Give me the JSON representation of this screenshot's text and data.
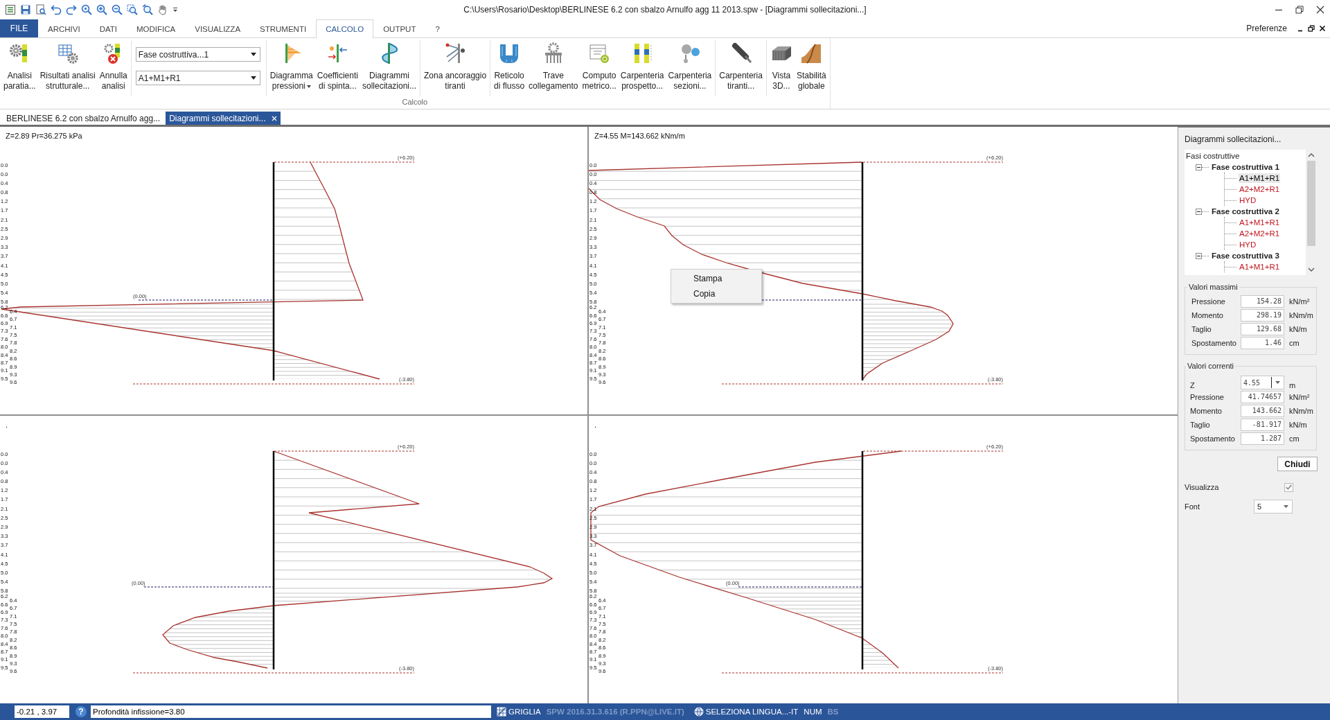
{
  "window": {
    "title": "C:\\Users\\Rosario\\Desktop\\BERLINESE 6.2 con sbalzo Arnulfo agg 11 2013.spw - [Diagrammi sollecitazioni...]"
  },
  "ribbon_tabs": [
    {
      "label": "FILE",
      "kind": "file",
      "selected": false
    },
    {
      "label": "ARCHIVI",
      "kind": "tab",
      "selected": false
    },
    {
      "label": "DATI",
      "kind": "tab",
      "selected": false
    },
    {
      "label": "MODIFICA",
      "kind": "tab",
      "selected": false
    },
    {
      "label": "VISUALIZZA",
      "kind": "tab",
      "selected": false
    },
    {
      "label": "STRUMENTI",
      "kind": "tab",
      "selected": false
    },
    {
      "label": "CALCOLO",
      "kind": "tab",
      "selected": true
    },
    {
      "label": "OUTPUT",
      "kind": "tab",
      "selected": false
    },
    {
      "label": "?",
      "kind": "tab",
      "selected": false
    }
  ],
  "preferences_link": "Preferenze",
  "ribbon": {
    "group_label": "Calcolo",
    "sections": [
      {
        "kind": "buttons",
        "items": [
          {
            "lines": [
              "Analisi",
              "paratia..."
            ],
            "has_menu": false
          },
          {
            "lines": [
              "Risultati analisi",
              "strutturale..."
            ],
            "has_menu": false
          },
          {
            "lines": [
              "Annulla",
              "analisi"
            ],
            "has_menu": false
          }
        ]
      },
      {
        "kind": "dropdowns",
        "items": [
          {
            "value": "Fase costruttiva...1"
          },
          {
            "value": "A1+M1+R1"
          }
        ]
      },
      {
        "kind": "buttons",
        "items": [
          {
            "lines": [
              "Diagramma",
              "pressioni"
            ],
            "has_menu": true
          },
          {
            "lines": [
              "Coefficienti",
              "di spinta..."
            ],
            "has_menu": false
          },
          {
            "lines": [
              "Diagrammi",
              "sollecitazioni..."
            ],
            "has_menu": false
          }
        ]
      },
      {
        "kind": "buttons",
        "items": [
          {
            "lines": [
              "Zona ancoraggio",
              "tiranti"
            ],
            "has_menu": false
          }
        ]
      },
      {
        "kind": "buttons",
        "items": [
          {
            "lines": [
              "Reticolo",
              "di flusso"
            ],
            "has_menu": false
          },
          {
            "lines": [
              "Trave",
              "collegamento"
            ],
            "has_menu": false
          },
          {
            "lines": [
              "Computo",
              "metrico..."
            ],
            "has_menu": false
          },
          {
            "lines": [
              "Carpenteria",
              "prospetto..."
            ],
            "has_menu": false
          },
          {
            "lines": [
              "Carpenteria",
              "sezioni..."
            ],
            "has_menu": false
          }
        ]
      },
      {
        "kind": "buttons",
        "items": [
          {
            "lines": [
              "Carpenteria",
              "tiranti..."
            ],
            "has_menu": false
          }
        ]
      },
      {
        "kind": "buttons",
        "items": [
          {
            "lines": [
              "Vista",
              "3D..."
            ],
            "has_menu": false
          },
          {
            "lines": [
              "Stabilità",
              "globale"
            ],
            "has_menu": false
          }
        ]
      }
    ]
  },
  "document_tabs": [
    {
      "label": "BERLINESE 6.2 con sbalzo Arnulfo agg...",
      "selected": false,
      "closable": false
    },
    {
      "label": "Diagrammi sollecitazioni...",
      "selected": true,
      "closable": true
    }
  ],
  "charts": [
    {
      "kind": "pressure",
      "header": "Z=2.89 Pr=36.275 kPa",
      "top_level": "(+6.20)",
      "excavation_level": "(0.00)",
      "bottom_level": "(-3.80)",
      "depth_labels": {
        "above_excavation": [
          "0.0",
          "0.0",
          "0.4",
          "0.8",
          "1.2",
          "1.7",
          "2.1",
          "2.5",
          "2.9",
          "3.3",
          "3.7",
          "4.1",
          "4.5",
          "5.0",
          "5.4",
          "5.8"
        ],
        "below_excavation": [
          "6.2",
          "6.4",
          "6.6",
          "6.7",
          "6.9",
          "7.1",
          "7.3",
          "7.5",
          "7.6",
          "7.8",
          "8.0",
          "8.2",
          "8.4",
          "8.6",
          "8.7",
          "8.9",
          "9.1",
          "9.3",
          "9.5",
          "9.6"
        ]
      }
    },
    {
      "kind": "moment",
      "header": "Z=4.55 M=143.662 kNm/m",
      "top_level": "(+6.20)",
      "bottom_level": "(-3.80)",
      "depth_labels": {
        "above_excavation": [
          "0.0",
          "0.0",
          "0.4",
          "0.8",
          "1.2",
          "1.7",
          "2.1",
          "2.5",
          "2.9",
          "3.3",
          "3.7",
          "4.1",
          "4.5",
          "5.0",
          "5.4",
          "5.8"
        ],
        "below_excavation": [
          "6.2",
          "6.4",
          "6.6",
          "6.7",
          "6.9",
          "7.1",
          "7.3",
          "7.5",
          "7.6",
          "7.8",
          "8.0",
          "8.2",
          "8.4",
          "8.6",
          "8.7",
          "8.9",
          "9.1",
          "9.3",
          "9.5",
          "9.6"
        ]
      },
      "context_menu": {
        "items": [
          "Stampa",
          "Copia"
        ]
      }
    },
    {
      "kind": "shear",
      "header": ".",
      "top_level": "(+6.20)",
      "excavation_level": "(0.00)",
      "bottom_level": "(-3.80)",
      "depth_labels": {
        "above_excavation": [
          "0.0",
          "0.0",
          "0.4",
          "0.8",
          "1.2",
          "1.7",
          "2.1",
          "2.5",
          "2.9",
          "3.3",
          "3.7",
          "4.1",
          "4.5",
          "5.0",
          "5.4",
          "5.8"
        ],
        "below_excavation": [
          "6.2",
          "6.4",
          "6.6",
          "6.7",
          "6.9",
          "7.1",
          "7.3",
          "7.5",
          "7.6",
          "7.8",
          "8.0",
          "8.2",
          "8.4",
          "8.6",
          "8.7",
          "8.9",
          "9.1",
          "9.3",
          "9.5",
          "9.6"
        ]
      }
    },
    {
      "kind": "displacement",
      "header": ".",
      "top_level": "(+6.20)",
      "excavation_level": "(0.00)",
      "bottom_level": "(-3.80)",
      "depth_labels": {
        "above_excavation": [
          "0.0",
          "0.0",
          "0.4",
          "0.8",
          "1.2",
          "1.7",
          "2.1",
          "2.5",
          "2.9",
          "3.3",
          "3.7",
          "4.1",
          "4.5",
          "5.0",
          "5.4",
          "5.8"
        ],
        "below_excavation": [
          "6.2",
          "6.4",
          "6.6",
          "6.7",
          "6.9",
          "7.1",
          "7.3",
          "7.5",
          "7.6",
          "7.8",
          "8.0",
          "8.2",
          "8.4",
          "8.6",
          "8.7",
          "8.9",
          "9.1",
          "9.3",
          "9.5",
          "9.6"
        ]
      }
    }
  ],
  "side_panel": {
    "title": "Diagrammi sollecitazioni...",
    "tree": {
      "label": "Fasi costruttive",
      "children": [
        {
          "label": "Fase costruttiva 1",
          "expanded": true,
          "children": [
            {
              "label": "A1+M1+R1",
              "color": "#000000",
              "selected": true
            },
            {
              "label": "A2+M2+R1",
              "color": "#c0141c",
              "selected": false
            },
            {
              "label": "HYD",
              "color": "#c0141c",
              "selected": false
            }
          ]
        },
        {
          "label": "Fase costruttiva 2",
          "expanded": true,
          "children": [
            {
              "label": "A1+M1+R1",
              "color": "#c0141c",
              "selected": false
            },
            {
              "label": "A2+M2+R1",
              "color": "#c0141c",
              "selected": false
            },
            {
              "label": "HYD",
              "color": "#c0141c",
              "selected": false
            }
          ]
        },
        {
          "label": "Fase costruttiva 3",
          "expanded": true,
          "children": [
            {
              "label": "A1+M1+R1",
              "color": "#c0141c",
              "selected": false
            }
          ]
        }
      ]
    },
    "max_values": {
      "title": "Valori massimi",
      "rows": [
        {
          "label": "Pressione",
          "value": "154.28",
          "unit": "kN/m²"
        },
        {
          "label": "Momento",
          "value": "298.19",
          "unit": "kNm/m"
        },
        {
          "label": "Taglio",
          "value": "129.68",
          "unit": "kN/m"
        },
        {
          "label": "Spostamento",
          "value": "1.46",
          "unit": "cm"
        }
      ]
    },
    "current_values": {
      "title": "Valori correnti",
      "rows": [
        {
          "kind": "combo",
          "label": "Z",
          "value": "4.55",
          "unit": "m"
        },
        {
          "kind": "field",
          "label": "Pressione",
          "value": "41.74657",
          "unit": "kN/m²"
        },
        {
          "kind": "field",
          "label": "Momento",
          "value": "143.662",
          "unit": "kNm/m"
        },
        {
          "kind": "field",
          "label": "Taglio",
          "value": "-81.917",
          "unit": "kN/m"
        },
        {
          "kind": "field",
          "label": "Spostamento",
          "value": "1.287",
          "unit": "cm"
        }
      ]
    },
    "close_button": "Chiudi",
    "show_option": {
      "label": "Visualizza",
      "checked": true
    },
    "font_option": {
      "label": "Font",
      "value": "5"
    }
  },
  "status_bar": {
    "coordinates": "-0.21 , 3.97",
    "help": "?",
    "message": "Profondità infissione=3.80",
    "indicators": [
      {
        "kind": "grid",
        "label": "GRIGLIA",
        "enabled": true
      },
      {
        "kind": "text",
        "label": "SPW 2016.31.3.616 (R.PPN@LIVE.IT)",
        "enabled": false
      },
      {
        "kind": "language",
        "label": "SELEZIONA LINGUA...-IT",
        "enabled": true
      },
      {
        "kind": "text",
        "label": "NUM",
        "enabled": true
      },
      {
        "kind": "text",
        "label": "BS",
        "enabled": false
      }
    ]
  }
}
